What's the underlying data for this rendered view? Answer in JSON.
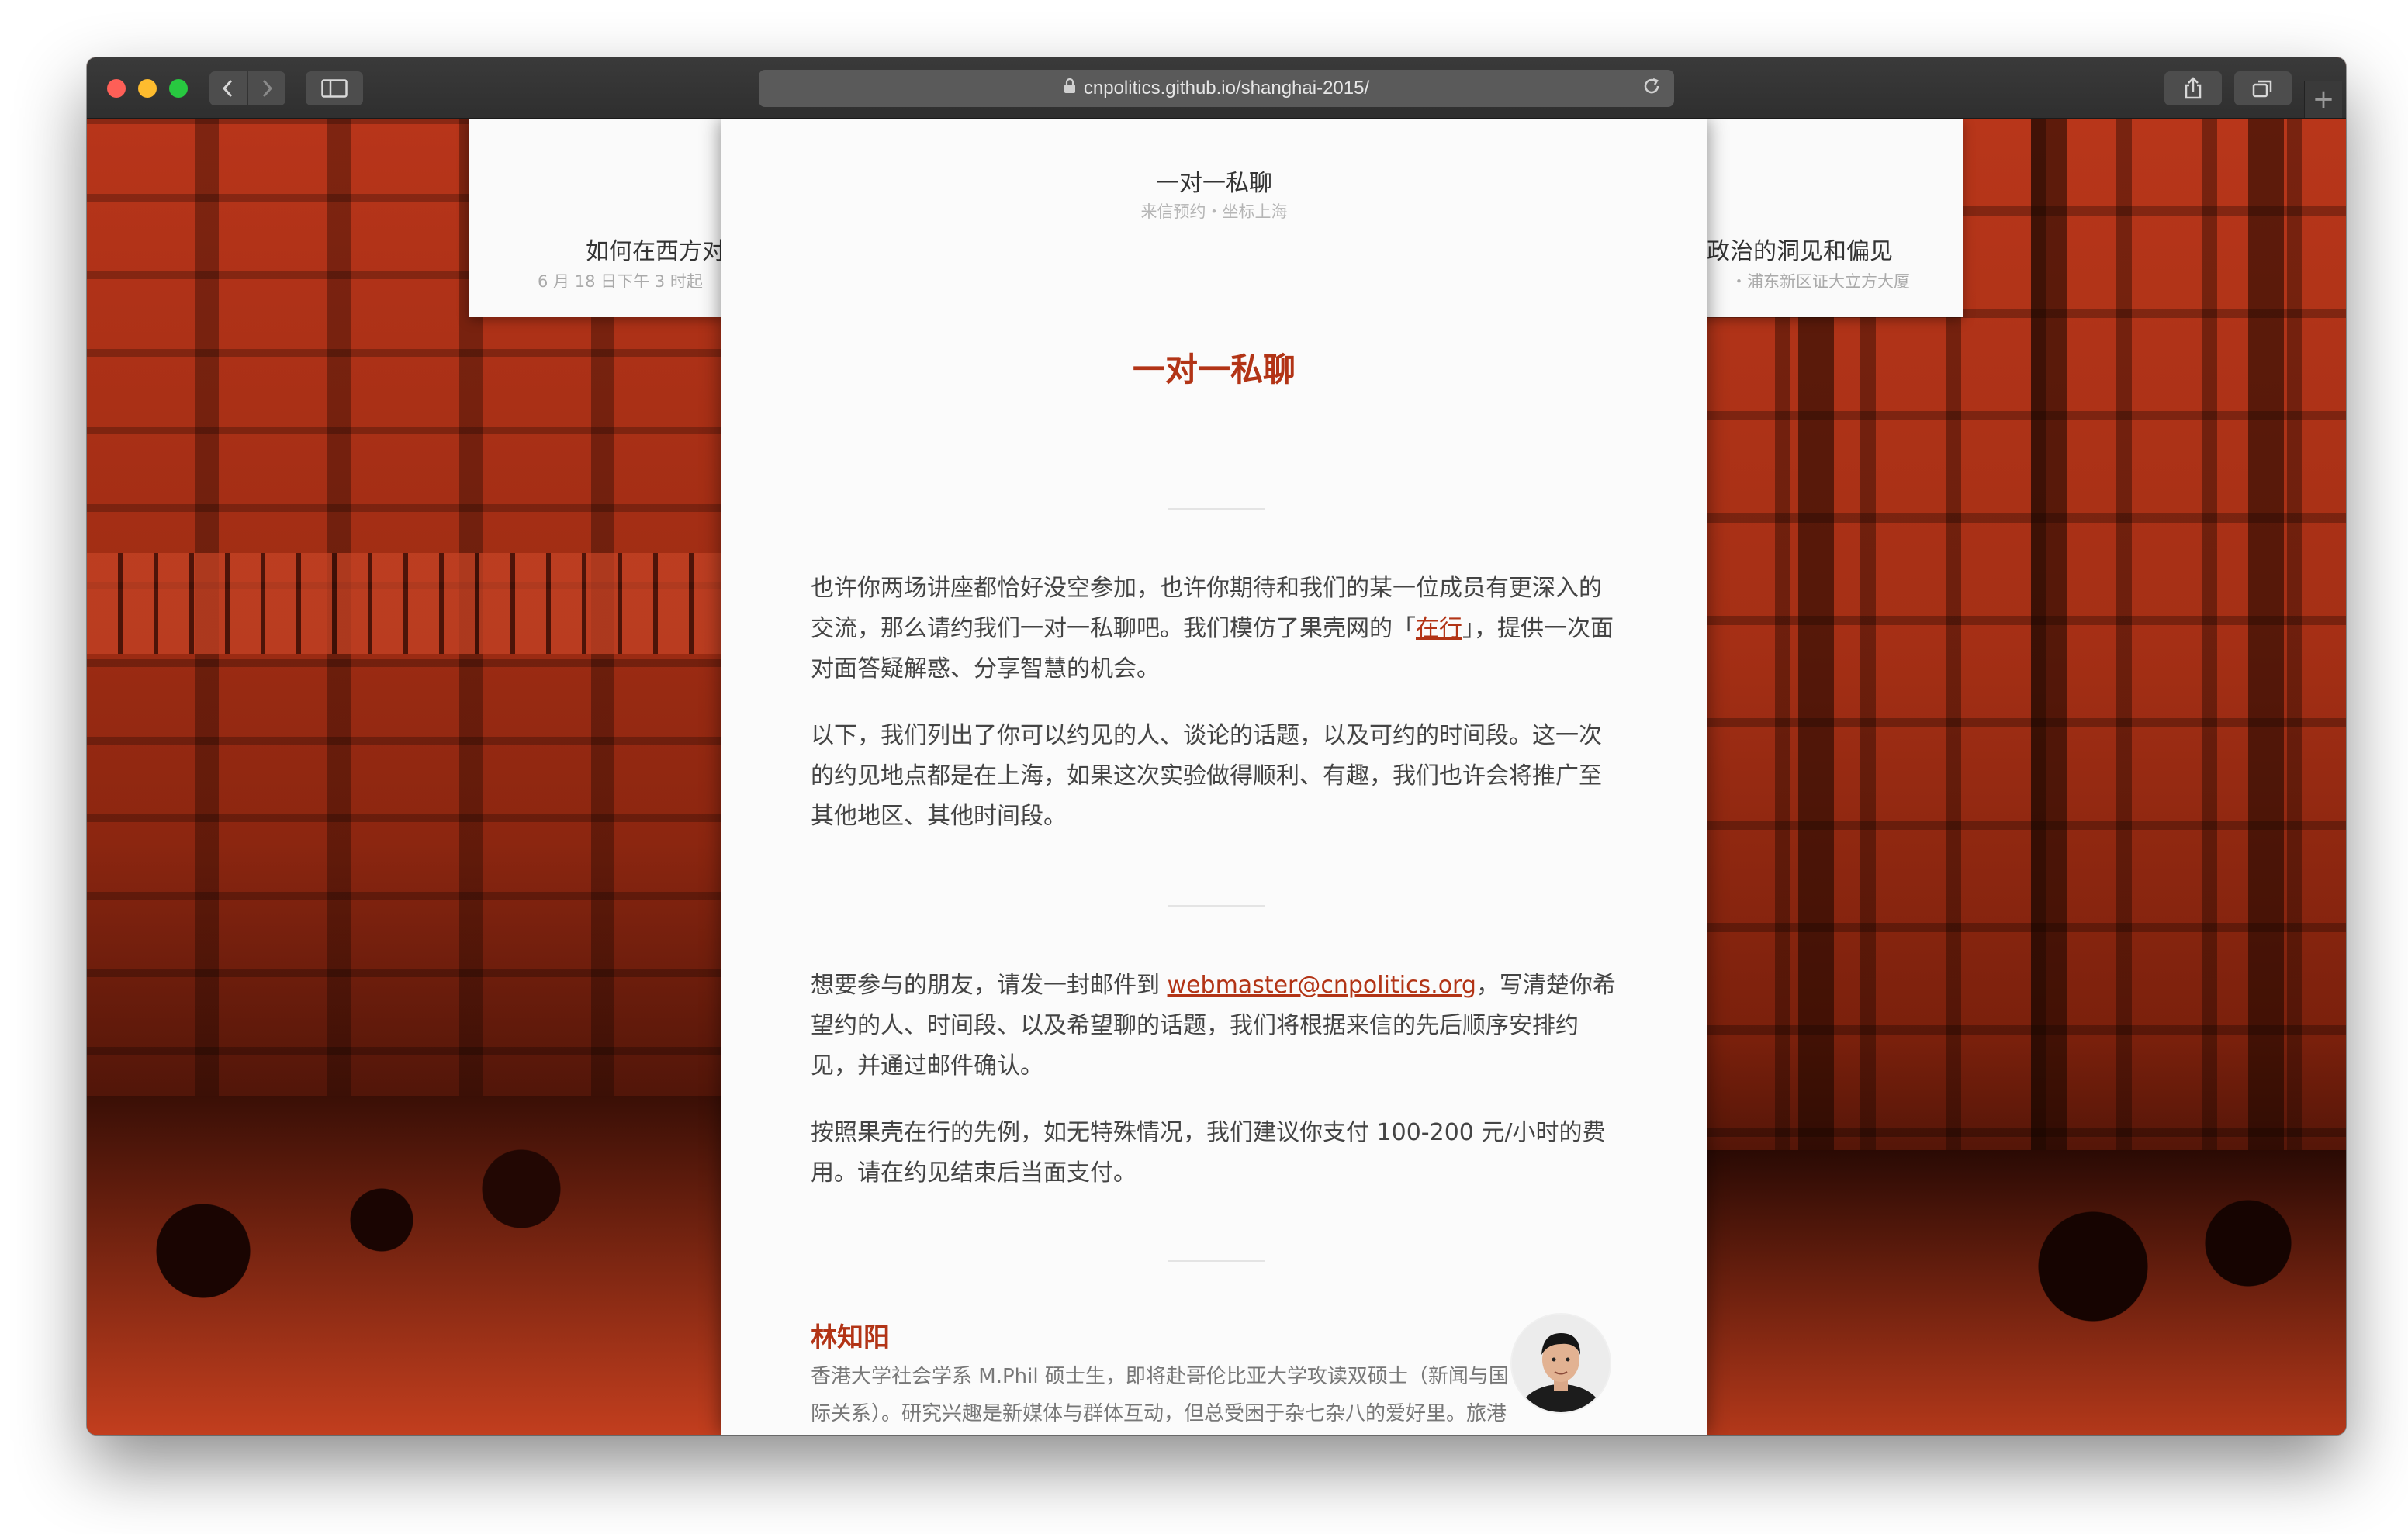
{
  "browser": {
    "url": "cnpolitics.github.io/shanghai-2015/",
    "back_icon": "chevron-left-icon",
    "forward_icon": "chevron-right-icon",
    "new_tab_label": "+"
  },
  "left_card": {
    "title": "如何在西方对",
    "subtitle": "6 月 18 日下午 3 时起"
  },
  "right_card": {
    "title": "政治的洞见和偏见",
    "subtitle": "・浦东新区证大立方大厦"
  },
  "main_card": {
    "header_title": "一对一私聊",
    "header_subtitle": "来信预约・坐标上海",
    "title": "一对一私聊",
    "para1_before": "也许你两场讲座都恰好没空参加，也许你期待和我们的某一位成员有更深入的交流，那么请约我们一对一私聊吧。我们模仿了果壳网的「",
    "para1_link": "在行",
    "para1_after": "」，提供一次面对面答疑解惑、分享智慧的机会。",
    "para2": "以下，我们列出了你可以约见的人、谈论的话题，以及可约的时间段。这一次的约见地点都是在上海，如果这次实验做得顺利、有趣，我们也许会将推广至其他地区、其他时间段。",
    "para3_before": "想要参与的朋友，请发一封邮件到 ",
    "para3_link": "webmaster@cnpolitics.org",
    "para3_after": "，写清楚你希望约的人、时间段、以及希望聊的话题，我们将根据来信的先后顺序安排约见，并通过邮件确认。",
    "para4": "按照果壳在行的先例，如无特殊情况，我们建议你支付 100-200 元/小时的费用。请在约见结束后当面支付。",
    "person": {
      "name": "林知阳",
      "bio": "香港大学社会学系 M.Phil 硕士生，即将赴哥伦比亚大学攻读双硕士（新闻与国际关系）。研究兴趣是新媒体与群体互动，但总受困于杂七杂八的爱好里。旅港填词人；于香港出版旅行文集《这颗行星上所有的酒馆》，并"
    }
  },
  "colors": {
    "accent": "#b23416",
    "background_tint": "#a8321a"
  }
}
